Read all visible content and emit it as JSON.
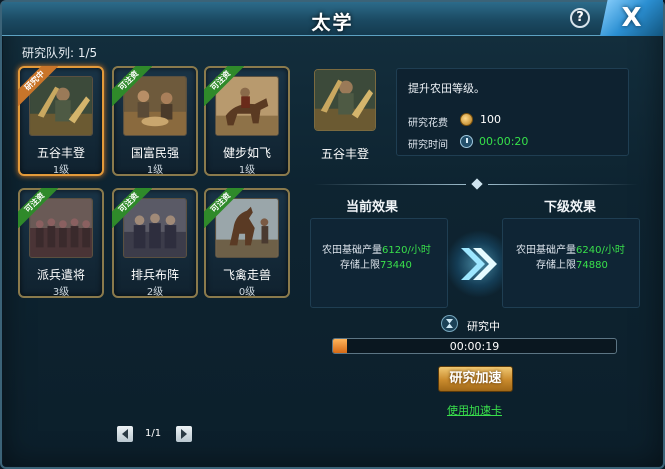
{
  "window": {
    "title": "太学",
    "help_label": "?",
    "close_label": "X"
  },
  "queue": {
    "label": "研究队列: 1/5"
  },
  "cards": [
    {
      "name": "五谷丰登",
      "level": "1级",
      "badge": "研究中",
      "badge_color": "#c9752a",
      "active": true
    },
    {
      "name": "国富民强",
      "level": "1级",
      "badge": "可注资",
      "badge_color": "#2f8a2a",
      "active": false
    },
    {
      "name": "健步如飞",
      "level": "1级",
      "badge": "可注资",
      "badge_color": "#2f8a2a",
      "active": false
    },
    {
      "name": "派兵遣将",
      "level": "3级",
      "badge": "可注资",
      "badge_color": "#2f8a2a",
      "active": false
    },
    {
      "name": "排兵布阵",
      "level": "2级",
      "badge": "可注资",
      "badge_color": "#2f8a2a",
      "active": false
    },
    {
      "name": "飞禽走兽",
      "level": "0级",
      "badge": "可注资",
      "badge_color": "#2f8a2a",
      "active": false
    }
  ],
  "selected": {
    "name": "五谷丰登",
    "description": "提升农田等级。",
    "cost_label": "研究花费",
    "cost_value": "100",
    "cost_icon": "coin-icon",
    "time_label": "研究时间",
    "time_value": "00:00:20",
    "time_icon": "clock-icon"
  },
  "effects": {
    "current_title": "当前效果",
    "next_title": "下级效果",
    "current": {
      "line1_prefix": "农田基础产量",
      "line1_value": "6120/小时",
      "line2_prefix": "存储上限",
      "line2_value": "73440"
    },
    "next": {
      "line1_prefix": "农田基础产量",
      "line1_value": "6240/小时",
      "line2_prefix": "存储上限",
      "line2_value": "74880"
    }
  },
  "status": {
    "label": "研究中",
    "icon": "hourglass-icon"
  },
  "progress": {
    "text": "00:00:19",
    "fraction": 0.05
  },
  "buttons": {
    "speed_up": "研究加速",
    "use_card": "使用加速卡"
  },
  "pagination": {
    "text": "1/1"
  },
  "colors": {
    "accent_green": "#39e04b",
    "badge_green": "#2f8a2a",
    "badge_orange": "#c9752a",
    "button_gold": "#c98a2c"
  }
}
